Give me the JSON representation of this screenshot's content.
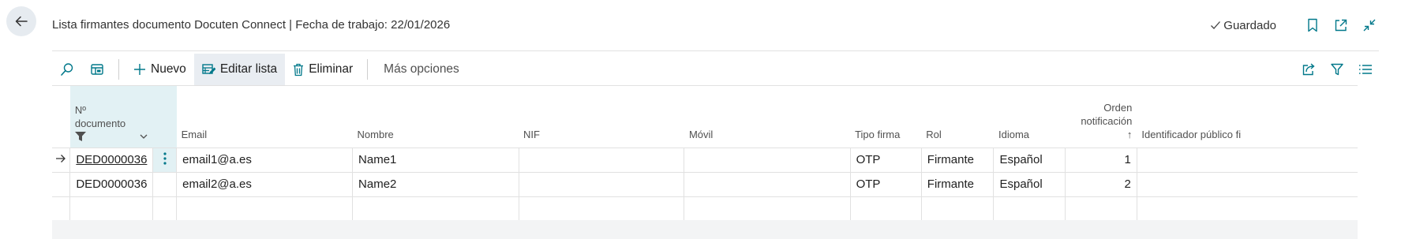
{
  "header": {
    "title": "Lista firmantes documento Docuten Connect | Fecha de trabajo: 22/01/2026",
    "saved_label": "Guardado"
  },
  "actions": {
    "new_label": "Nuevo",
    "edit_list_label": "Editar lista",
    "delete_label": "Eliminar",
    "more_label": "Más opciones"
  },
  "table": {
    "columns": {
      "doc_no_line1": "Nº",
      "doc_no_line2": "documento",
      "email": "Email",
      "nombre": "Nombre",
      "nif": "NIF",
      "movil": "Móvil",
      "tipo_firma": "Tipo firma",
      "rol": "Rol",
      "idioma": "Idioma",
      "orden_line1": "Orden",
      "orden_line2": "notificación",
      "orden_sort": "↑",
      "identificador": "Identificador público fi"
    },
    "rows": [
      {
        "doc_no": "DED0000036",
        "email": "email1@a.es",
        "nombre": "Name1",
        "nif": "",
        "movil": "",
        "tipo_firma": "OTP",
        "rol": "Firmante",
        "idioma": "Español",
        "orden": "1",
        "identificador": ""
      },
      {
        "doc_no": "DED0000036",
        "email": "email2@a.es",
        "nombre": "Name2",
        "nif": "",
        "movil": "",
        "tipo_firma": "OTP",
        "rol": "Firmante",
        "idioma": "Español",
        "orden": "2",
        "identificador": ""
      }
    ]
  },
  "icons": {
    "back": "arrow-left-icon",
    "saved": "checkmark-icon",
    "bookmark": "bookmark-icon",
    "open_new": "open-in-new-window-icon",
    "collapse": "collapse-icon",
    "search": "search-icon",
    "layout": "layout-icon",
    "plus": "plus-icon",
    "edit_list": "edit-list-icon",
    "delete": "trash-icon",
    "share": "share-icon",
    "filter": "filter-icon",
    "list": "list-view-icon",
    "row_indicator": "arrow-right-icon",
    "row_menu": "more-vertical-icon"
  },
  "colors": {
    "accent": "#00788a",
    "selected_column": "#e2f1f4",
    "back_button": "#e6ebf0"
  }
}
